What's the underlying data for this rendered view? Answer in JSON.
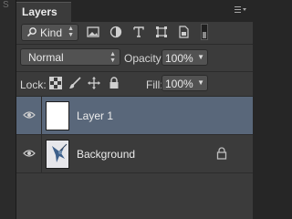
{
  "sidebar_letter": "S",
  "panel": {
    "tab_title": "Layers",
    "menu_icon": "panel-menu-icon"
  },
  "filter": {
    "kind_label": "Kind",
    "icons": [
      "pixel-filter-icon",
      "adjustment-filter-icon",
      "type-filter-icon",
      "shape-filter-icon",
      "smart-object-filter-icon",
      "filter-toggle-icon"
    ]
  },
  "blend": {
    "mode": "Normal",
    "opacity_label": "Opacity:",
    "opacity_value": "100%"
  },
  "lock": {
    "label": "Lock:",
    "icons": [
      "lock-transparency-icon",
      "lock-image-pixels-icon",
      "lock-position-icon",
      "lock-all-icon"
    ],
    "fill_label": "Fill:",
    "fill_value": "100%"
  },
  "layers": [
    {
      "name": "Layer 1",
      "selected": true,
      "visible": true,
      "locked": false
    },
    {
      "name": "Background",
      "selected": false,
      "visible": true,
      "locked": true
    }
  ],
  "colors": {
    "selected_row": "#59677a",
    "panel_bg": "#3b3b3b",
    "field_bg": "#525252"
  }
}
